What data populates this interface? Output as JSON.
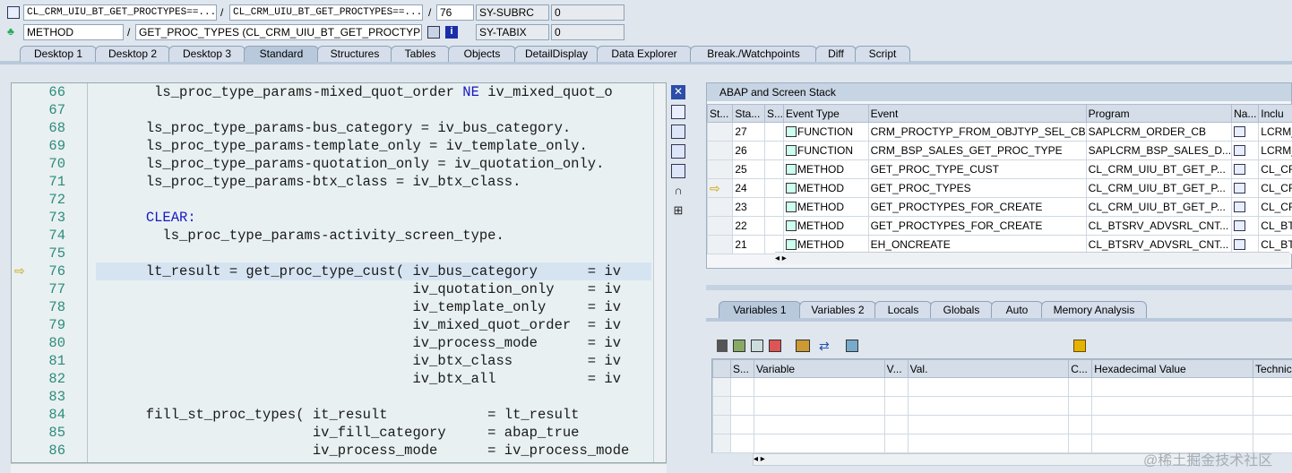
{
  "header": {
    "row1": {
      "class_field": "CL_CRM_UIU_BT_GET_PROCTYPES==...",
      "sep1": "/",
      "include_field": "CL_CRM_UIU_BT_GET_PROCTYPES==...",
      "sep2": "/",
      "line_field": "76",
      "sysvar_label": "SY-SUBRC",
      "sysvar_value": "0"
    },
    "row2": {
      "type_field": "METHOD",
      "sep": "/",
      "proc_field": "GET_PROC_TYPES (CL_CRM_UIU_BT_GET_PROCTYPES)",
      "sysvar_label": "SY-TABIX",
      "sysvar_value": "0"
    }
  },
  "tabs": [
    "Desktop 1",
    "Desktop 2",
    "Desktop 3",
    "Standard",
    "Structures",
    "Tables",
    "Objects",
    "DetailDisplay",
    "Data Explorer",
    "Break./Watchpoints",
    "Diff",
    "Script"
  ],
  "active_tab": "Standard",
  "editor": {
    "current_line": "76",
    "lines": [
      {
        "n": "66",
        "t": "       ls_proc_type_params-mixed_quot_order NE iv_mixed_quot_o"
      },
      {
        "n": "67",
        "t": ""
      },
      {
        "n": "68",
        "t": "      ls_proc_type_params-bus_category = iv_bus_category."
      },
      {
        "n": "69",
        "t": "      ls_proc_type_params-template_only = iv_template_only."
      },
      {
        "n": "70",
        "t": "      ls_proc_type_params-quotation_only = iv_quotation_only."
      },
      {
        "n": "71",
        "t": "      ls_proc_type_params-btx_class = iv_btx_class."
      },
      {
        "n": "72",
        "t": ""
      },
      {
        "n": "73",
        "t": "      CLEAR:"
      },
      {
        "n": "74",
        "t": "        ls_proc_type_params-activity_screen_type."
      },
      {
        "n": "75",
        "t": ""
      },
      {
        "n": "76",
        "t": "      lt_result = get_proc_type_cust( iv_bus_category      = iv"
      },
      {
        "n": "77",
        "t": "                                      iv_quotation_only    = iv"
      },
      {
        "n": "78",
        "t": "                                      iv_template_only     = iv"
      },
      {
        "n": "79",
        "t": "                                      iv_mixed_quot_order  = iv"
      },
      {
        "n": "80",
        "t": "                                      iv_process_mode      = iv"
      },
      {
        "n": "81",
        "t": "                                      iv_btx_class         = iv"
      },
      {
        "n": "82",
        "t": "                                      iv_btx_all           = iv"
      },
      {
        "n": "83",
        "t": ""
      },
      {
        "n": "84",
        "t": "      fill_st_proc_types( it_result            = lt_result"
      },
      {
        "n": "85",
        "t": "                          iv_fill_category     = abap_true"
      },
      {
        "n": "86",
        "t": "                          iv_process_mode      = iv_process_mode"
      }
    ]
  },
  "stack": {
    "title": "ABAP and Screen Stack",
    "columns": [
      "St...",
      "Sta...",
      "S...",
      "Event Type",
      "Event",
      "Program",
      "Na...",
      "Inclu"
    ],
    "rows": [
      {
        "level": "27",
        "type": "FUNCTION",
        "event": "CRM_PROCTYP_FROM_OBJTYP_SEL_CB",
        "program": "SAPLCRM_ORDER_CB",
        "include": "LCRM_",
        "current": false
      },
      {
        "level": "26",
        "type": "FUNCTION",
        "event": "CRM_BSP_SALES_GET_PROC_TYPE",
        "program": "SAPLCRM_BSP_SALES_D...",
        "include": "LCRM_",
        "current": false
      },
      {
        "level": "25",
        "type": "METHOD",
        "event": "GET_PROC_TYPE_CUST",
        "program": "CL_CRM_UIU_BT_GET_P...",
        "include": "CL_CF",
        "current": false
      },
      {
        "level": "24",
        "type": "METHOD",
        "event": "GET_PROC_TYPES",
        "program": "CL_CRM_UIU_BT_GET_P...",
        "include": "CL_CF",
        "current": true
      },
      {
        "level": "23",
        "type": "METHOD",
        "event": "GET_PROCTYPES_FOR_CREATE",
        "program": "CL_CRM_UIU_BT_GET_P...",
        "include": "CL_CF",
        "current": false
      },
      {
        "level": "22",
        "type": "METHOD",
        "event": "GET_PROCTYPES_FOR_CREATE",
        "program": "CL_BTSRV_ADVSRL_CNT...",
        "include": "CL_BT",
        "current": false
      },
      {
        "level": "21",
        "type": "METHOD",
        "event": "EH_ONCREATE",
        "program": "CL_BTSRV_ADVSRL_CNT...",
        "include": "CL_BT",
        "current": false
      }
    ]
  },
  "var_tabs": [
    "Variables 1",
    "Variables 2",
    "Locals",
    "Globals",
    "Auto",
    "Memory Analysis"
  ],
  "active_var_tab": "Variables 1",
  "var_columns": [
    "S...",
    "Variable",
    "V...",
    "Val.",
    "C...",
    "Hexadecimal Value",
    "Technic"
  ],
  "watermark": "@稀土掘金技术社区"
}
